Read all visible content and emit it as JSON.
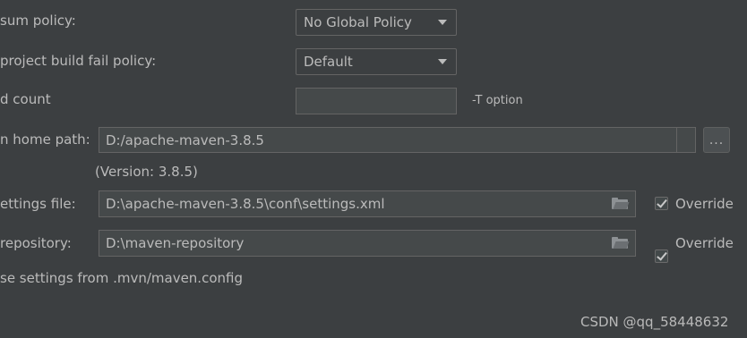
{
  "rows": {
    "checksum_policy": {
      "label": "sum policy:",
      "value": "No Global Policy"
    },
    "build_fail_policy": {
      "label": "project build fail policy:",
      "value": "Default"
    },
    "thread_count": {
      "label": "d count",
      "value": "",
      "hint": "-T option"
    },
    "home_path": {
      "label": "n home path:",
      "value": "D:/apache-maven-3.8.5",
      "browse": "...",
      "version": "(Version: 3.8.5)"
    },
    "settings_file": {
      "label": "ettings file:",
      "value": "D:\\apache-maven-3.8.5\\conf\\settings.xml",
      "override": "Override",
      "override_checked": true
    },
    "local_repo": {
      "label": "repository:",
      "value": "D:\\maven-repository",
      "override": "Override",
      "override_checked": true
    },
    "mvn_config": {
      "label": "se settings from .mvn/maven.config"
    }
  },
  "watermark": "CSDN @qq_58448632",
  "icons": [
    "chevron-down-icon",
    "folder-icon",
    "checkmark-icon"
  ]
}
